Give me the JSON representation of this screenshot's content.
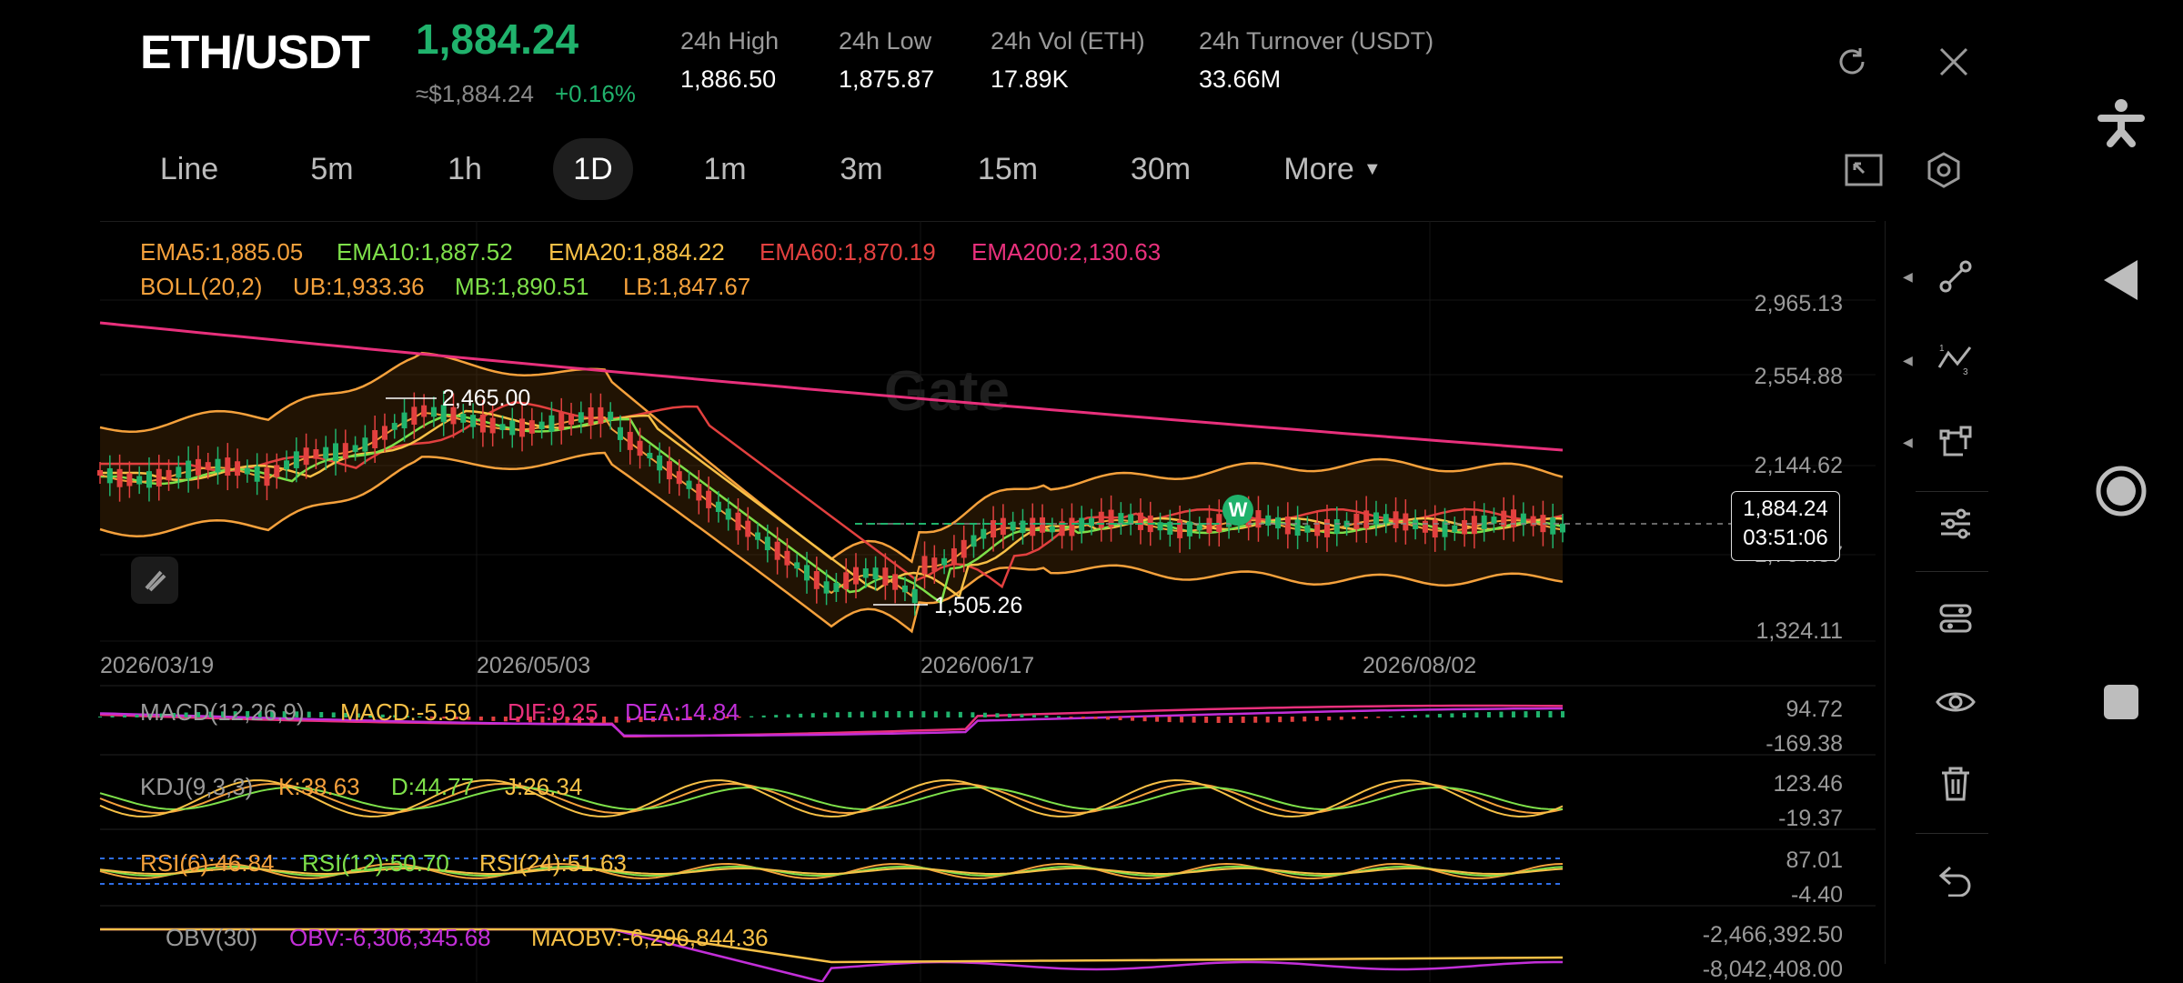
{
  "header": {
    "pair": "ETH/USDT",
    "price": "1,884.24",
    "approx_usd": "≈$1,884.24",
    "change": "+0.16%",
    "stats": [
      {
        "label": "24h   High",
        "value": "1,886.50"
      },
      {
        "label": "24h   Low",
        "value": "1,875.87"
      },
      {
        "label": "24h   Vol (ETH)",
        "value": "17.89K"
      },
      {
        "label": "24h   Turnover (USDT)",
        "value": "33.66M"
      }
    ],
    "refresh_icon": "refresh-icon",
    "close_icon": "close-icon"
  },
  "timeframes": {
    "items": [
      "Line",
      "5m",
      "1h",
      "1D",
      "1m",
      "3m",
      "15m",
      "30m",
      "More"
    ],
    "active": "1D"
  },
  "chart": {
    "watermark": "Gate",
    "ema_labels": [
      "EMA5:1,885.05",
      "EMA10:1,887.52",
      "EMA20:1,884.22",
      "EMA60:1,870.19",
      "EMA200:2,130.63"
    ],
    "boll_labels": [
      "BOLL(20,2)",
      "UB:1,933.36",
      "MB:1,890.51",
      "LB:1,847.67"
    ],
    "y_axis": [
      "2,965.13",
      "2,554.88",
      "2,144.62",
      "1,764.37",
      "1,324.11"
    ],
    "x_axis": [
      "2026/03/19",
      "2026/05/03",
      "2026/06/17",
      "2026/08/02"
    ],
    "high_marker": "2,465.00",
    "low_marker": "1,505.26",
    "current_price": "1,884.24",
    "countdown": "03:51:06",
    "badge": "W",
    "colors": {
      "ema5": "#f5a13c",
      "ema10": "#7ee04a",
      "ema20": "#f7c046",
      "ema60": "#e2403f",
      "ema200": "#e8307c",
      "up": "#20b26c",
      "down": "#e2403f",
      "boll": "#f5a13c"
    }
  },
  "macd": {
    "labels": [
      "MACD(12,26,9)",
      "MACD:-5.59",
      "DIF:9.25",
      "DEA:14.84"
    ],
    "y_axis": [
      "94.72",
      "-169.38"
    ]
  },
  "kdj": {
    "labels": [
      "KDJ(9,3,3)",
      "K:38.63",
      "D:44.77",
      "J:26.34"
    ],
    "y_axis": [
      "123.46",
      "-19.37"
    ]
  },
  "rsi": {
    "labels": [
      "RSI(6):46.84",
      "RSI(12):50.70",
      "RSI(24):51.63"
    ],
    "y_axis": [
      "87.01",
      "-4.40"
    ]
  },
  "obv": {
    "labels": [
      "OBV(30)",
      "OBV:-6,306,345.68",
      "MAOBV:-6,296,844.36"
    ],
    "y_axis": [
      "-2,466,392.50",
      "-8,042,408.00"
    ]
  },
  "toolbar": {
    "tools": [
      "line-tool-icon",
      "fibonacci-tool-icon",
      "shape-tool-icon",
      "indicator-settings-icon",
      "layout-settings-icon",
      "visibility-icon",
      "delete-icon",
      "undo-icon"
    ],
    "top": [
      "fullscreen-icon",
      "chart-settings-icon"
    ]
  },
  "system_nav": [
    "accessibility-icon",
    "back-icon",
    "home-icon",
    "recents-icon"
  ]
}
